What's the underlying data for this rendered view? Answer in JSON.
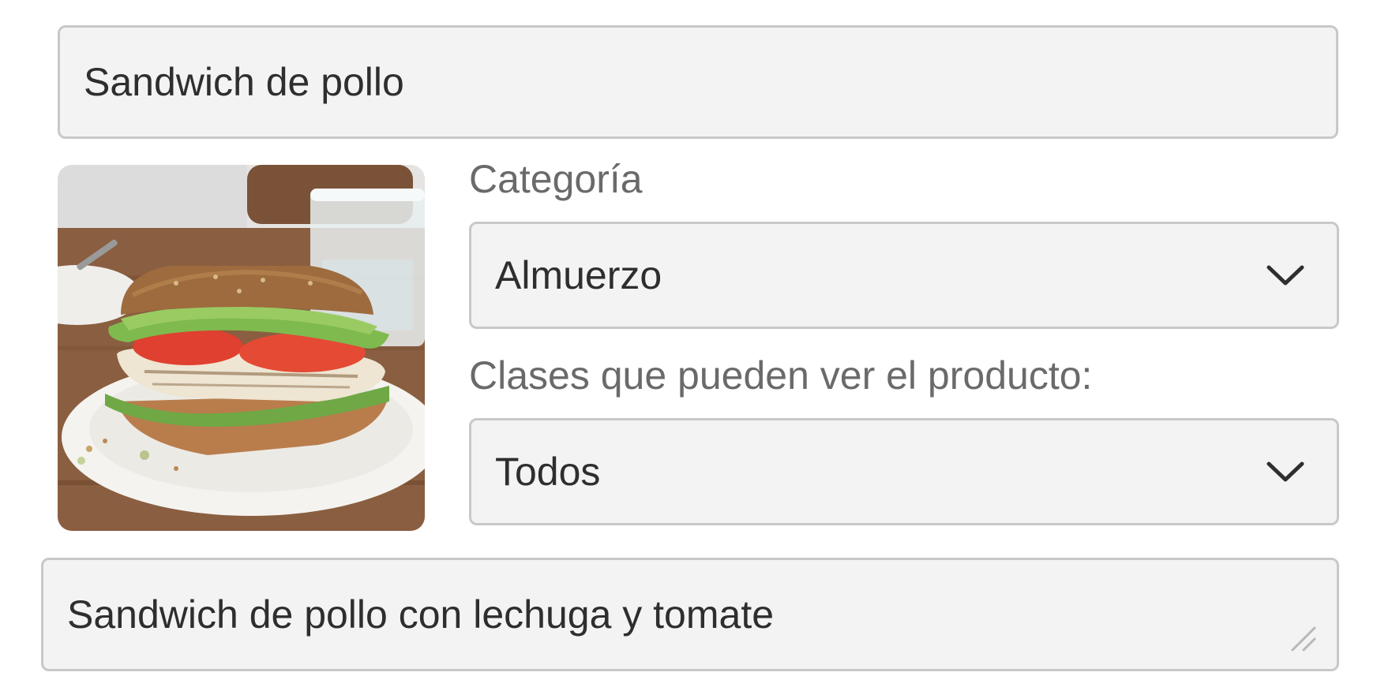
{
  "form": {
    "name_value": "Sandwich de pollo",
    "category_label": "Categoría",
    "category_value": "Almuerzo",
    "classes_label": "Clases que pueden ver el producto:",
    "classes_value": "Todos",
    "description_value": "Sandwich de pollo con lechuga y tomate"
  },
  "icons": {
    "category_dropdown": "chevron-down-icon",
    "classes_dropdown": "chevron-down-icon",
    "resize": "resize-handle-icon"
  },
  "colors": {
    "field_background": "#f3f3f3",
    "field_border": "#c8c8c8",
    "text": "#2e2e2e",
    "label": "#6a6a6a"
  }
}
